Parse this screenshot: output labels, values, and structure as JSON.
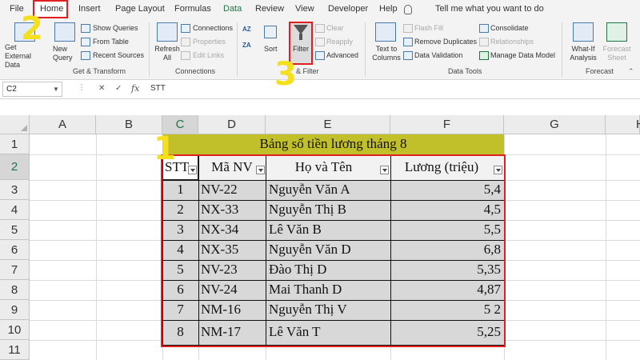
{
  "ribbon_tabs": [
    "File",
    "Home",
    "Insert",
    "Page Layout",
    "Formulas",
    "Data",
    "Review",
    "View",
    "Developer",
    "Help"
  ],
  "tell_me": "Tell me what you want to do",
  "ribbon": {
    "get_external_data": "Get External Data",
    "new_query": "New Query",
    "show_queries": "Show Queries",
    "from_table": "From Table",
    "recent_sources": "Recent Sources",
    "get_transform": "Get & Transform",
    "refresh_all": "Refresh All",
    "connections": "Connections",
    "properties": "Properties",
    "edit_links": "Edit Links",
    "connections_group": "Connections",
    "sort": "Sort",
    "filter": "Filter",
    "clear": "Clear",
    "reapply": "Reapply",
    "advanced": "Advanced",
    "sort_filter_group": "& Filter",
    "text_to_columns": "Text to Columns",
    "flash_fill": "Flash Fill",
    "remove_duplicates": "Remove Duplicates",
    "data_validation": "Data Validation",
    "consolidate": "Consolidate",
    "relationships": "Relationships",
    "manage_data_model": "Manage Data Model",
    "data_tools_group": "Data Tools",
    "what_if": "What-If Analysis",
    "forecast_sheet": "Forecast Sheet",
    "forecast_group": "Forecast",
    "az_icon": "AZ",
    "za_icon": "ZA"
  },
  "formula_bar": {
    "cell_ref": "C2",
    "content": "STT"
  },
  "columns": [
    "A",
    "B",
    "C",
    "D",
    "E",
    "F",
    "G",
    "H"
  ],
  "rows": [
    "1",
    "2",
    "3",
    "4",
    "5",
    "6",
    "7",
    "8",
    "9",
    "10",
    "11"
  ],
  "table": {
    "title": "Bảng số tiền lương tháng 8",
    "headers": [
      "STT",
      "Mã NV",
      "Họ và Tên",
      "Lương (triệu)"
    ],
    "rows": [
      [
        "1",
        "NV-22",
        "Nguyễn Văn A",
        "5,4"
      ],
      [
        "2",
        "NX-33",
        "Nguyễn Thị B",
        "4,5"
      ],
      [
        "3",
        "NX-34",
        "Lê Văn B",
        "5,5"
      ],
      [
        "4",
        "NX-35",
        "Nguyễn Văn D",
        "6,8"
      ],
      [
        "5",
        "NV-23",
        "Đào Thị D",
        "5,35"
      ],
      [
        "6",
        "NV-24",
        "Mai Thanh D",
        "4,87"
      ],
      [
        "7",
        "NM-16",
        "Nguyễn Thị V",
        "5 2"
      ],
      [
        "8",
        "NM-17",
        "Lê Văn T",
        "5,25"
      ]
    ]
  },
  "step_labels": [
    "1",
    "2",
    "3"
  ],
  "colors": {
    "excel_green": "#217346",
    "title_band": "#c2c02a",
    "highlight_red": "#e02020",
    "step_yellow": "#f4e01c"
  }
}
